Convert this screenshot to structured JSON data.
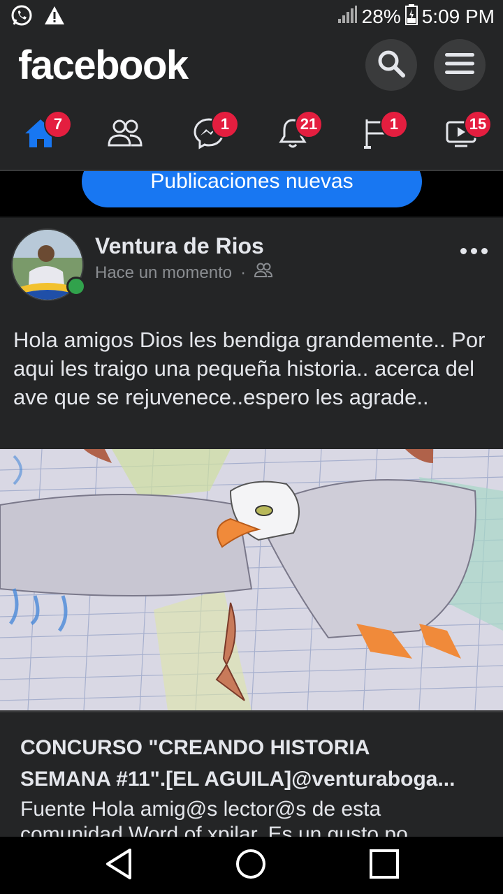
{
  "status_bar": {
    "battery": "28%",
    "time": "5:09 PM",
    "icons": [
      "whatsapp-icon",
      "warning-icon",
      "signal-icon",
      "battery-icon"
    ]
  },
  "header": {
    "logo": "facebook",
    "actions": [
      "search-icon",
      "menu-icon"
    ]
  },
  "nav": {
    "items": [
      {
        "name": "home",
        "icon": "home-icon",
        "badge": "7",
        "active": true
      },
      {
        "name": "friends",
        "icon": "friends-icon",
        "badge": ""
      },
      {
        "name": "messenger",
        "icon": "messenger-icon",
        "badge": "1"
      },
      {
        "name": "notifications",
        "icon": "bell-icon",
        "badge": "21"
      },
      {
        "name": "pages",
        "icon": "flag-icon",
        "badge": "1"
      },
      {
        "name": "watch",
        "icon": "video-icon",
        "badge": "15"
      }
    ]
  },
  "feed": {
    "new_posts_label": "Publicaciones nuevas"
  },
  "post": {
    "author": "Ventura de Rios",
    "time": "Hace un momento",
    "separator": "·",
    "privacy_icon": "friends-icon",
    "text": "Hola amigos Dios les bendiga grandemente.. Por aqui les traigo una pequeña historia.. acerca del ave que se rejuvenece..espero les agrade..",
    "link": {
      "title_line1": "CONCURSO \"CREANDO HISTORIA",
      "title_line2": "SEMANA #11\".[EL AGUILA]@venturaboga...",
      "description": "Fuente Hola amig@s lector@s de esta comunidad Word of xpilar. Es un gusto po"
    }
  },
  "colors": {
    "background": "#18191a",
    "surface": "#242526",
    "accent": "#1877f2",
    "badge": "#e41e3f",
    "online": "#31a24c"
  }
}
